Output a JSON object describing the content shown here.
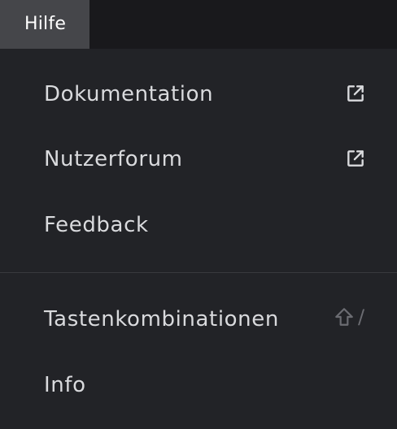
{
  "menubar": {
    "active_menu": "Hilfe"
  },
  "menu": {
    "items": [
      {
        "label": "Dokumentation",
        "icon": "external-link-icon"
      },
      {
        "label": "Nutzerforum",
        "icon": "external-link-icon"
      },
      {
        "label": "Feedback"
      },
      {
        "label": "Tastenkombinationen",
        "shortcut_key": "/",
        "shortcut_modifier": "shift-icon"
      },
      {
        "label": "Info"
      }
    ]
  },
  "colors": {
    "menubar_bg": "#19191c",
    "active_menu_bg": "#45464a",
    "dropdown_bg": "#222327",
    "text": "#d9dadd",
    "muted": "#6b6c72"
  }
}
